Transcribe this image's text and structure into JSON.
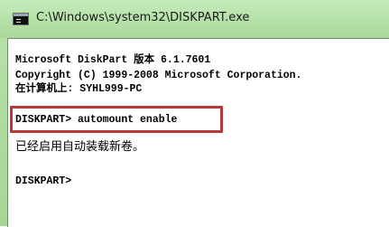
{
  "window": {
    "title": "C:\\Windows\\system32\\DISKPART.exe"
  },
  "console": {
    "lines": [
      "Microsoft DiskPart 版本 6.1.7601",
      "Copyright (C) 1999-2008 Microsoft Corporation.",
      "在计算机上: SYHL999-PC",
      "DISKPART> automount enable",
      "已经启用自动装载新卷。",
      "DISKPART>"
    ]
  },
  "highlight_color": "#b23a38"
}
